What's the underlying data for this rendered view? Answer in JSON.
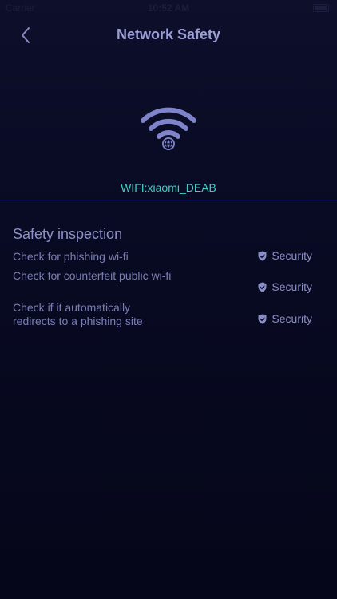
{
  "status_bar": {
    "carrier": "Carrier",
    "time": "10:52 AM"
  },
  "nav": {
    "title": "Network Safety"
  },
  "wifi": {
    "name": "WIFI:xiaomi_DEAB"
  },
  "inspection": {
    "title": "Safety inspection",
    "checks": [
      {
        "label": "Check for phishing wi-fi",
        "status": "Security"
      },
      {
        "label": "Check for counterfeit public wi-fi",
        "status": "Security"
      },
      {
        "label": "Check if it automatically redirects to a phishing site",
        "status": "Security"
      }
    ]
  },
  "colors": {
    "background": "#0b0d26",
    "title": "#9c9ed8",
    "wifi_name": "#3fd0c6",
    "text": "#7b7db5",
    "icon": "#7f83c9"
  },
  "icons": {
    "back": "chevron-left-icon",
    "wifi": "wifi-globe-icon",
    "status": "shield-check-icon"
  }
}
